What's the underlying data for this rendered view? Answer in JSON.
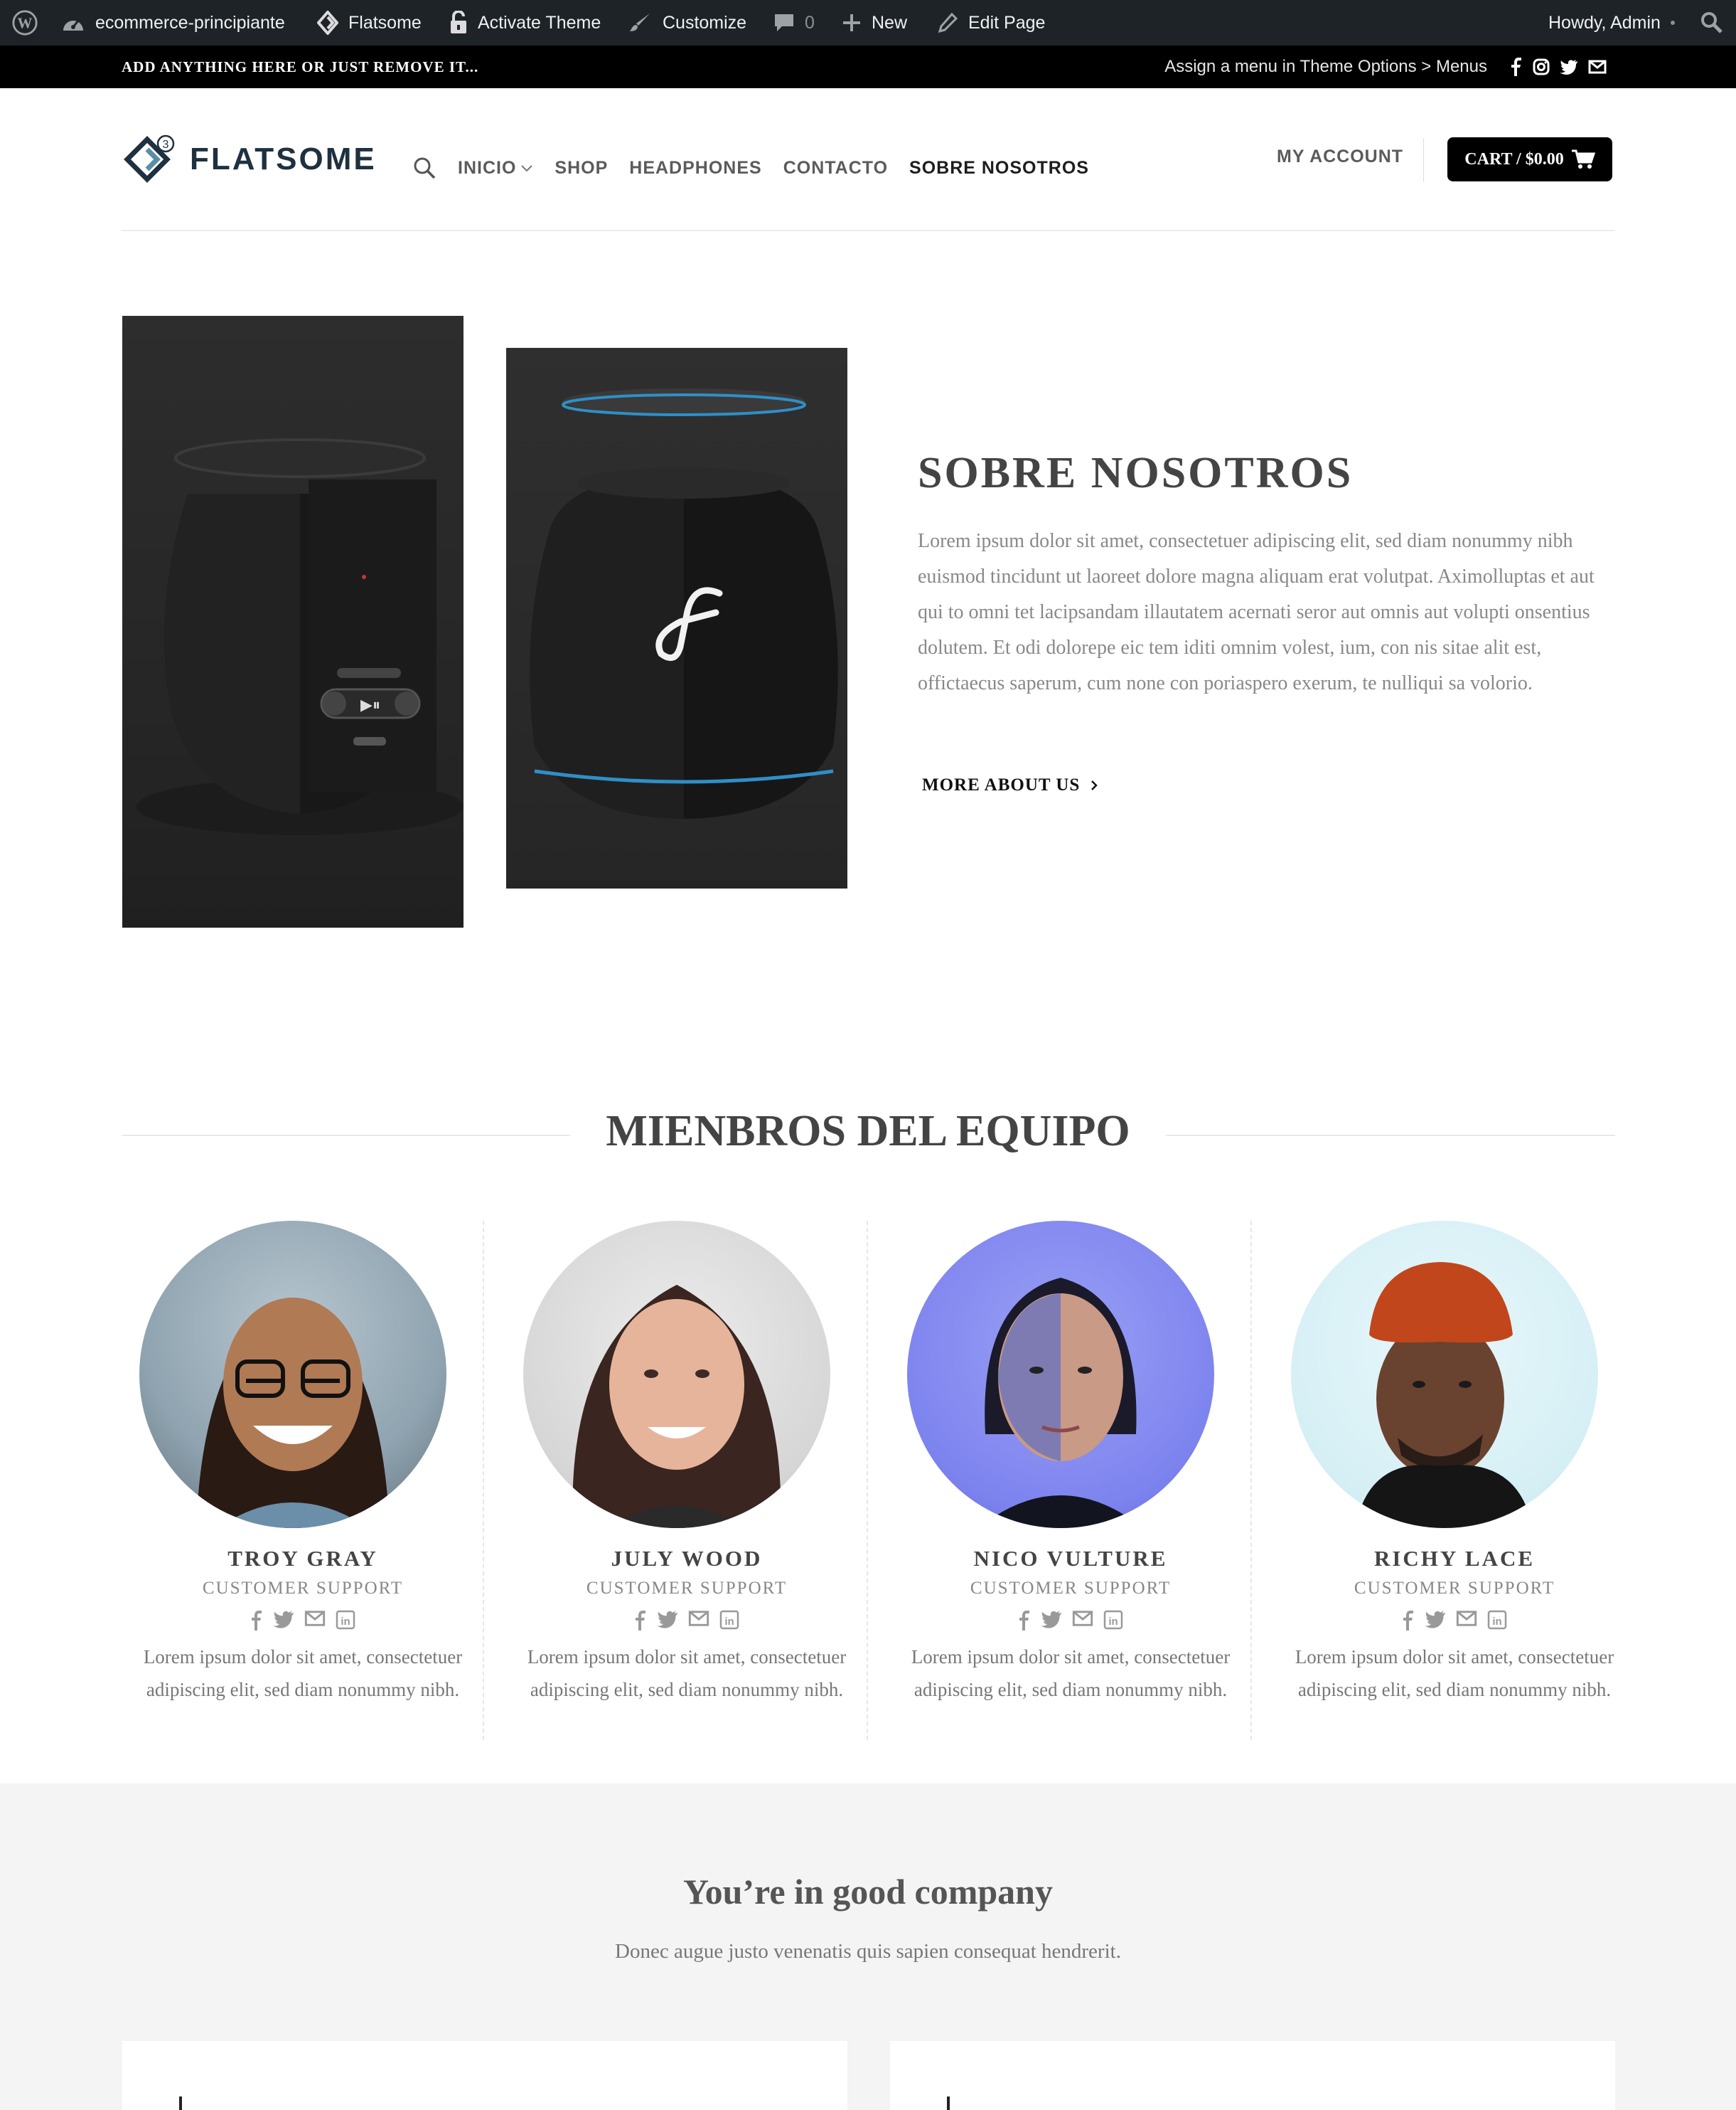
{
  "admin_bar": {
    "site_name": "ecommerce-principiante",
    "theme_name": "Flatsome",
    "activate_theme": "Activate Theme",
    "customize": "Customize",
    "comments_count": "0",
    "new": "New",
    "edit_page": "Edit Page",
    "howdy": "Howdy, Admin"
  },
  "top_bar": {
    "left_text": "ADD ANYTHING HERE OR JUST REMOVE IT...",
    "right_text": "Assign a menu in Theme Options > Menus",
    "social_icons": [
      "facebook-icon",
      "instagram-icon",
      "twitter-icon",
      "email-icon"
    ]
  },
  "header": {
    "logo_text": "FLATSOME",
    "logo_badge": "3",
    "nav": [
      "INICIO",
      "SHOP",
      "HEADPHONES",
      "CONTACTO",
      "SOBRE NOSOTROS"
    ],
    "nav_active": "SOBRE NOSOTROS",
    "my_account": "MY ACCOUNT",
    "cart": "CART / $0.00"
  },
  "about": {
    "title": "SOBRE NOSOTROS",
    "text": "Lorem ipsum dolor sit amet, consectetuer adipiscing elit, sed diam nonummy nibh euismod tincidunt ut laoreet dolore magna aliquam erat volutpat. Aximolluptas et aut qui to omni tet lacipsandam illautatem acernati seror aut omnis aut volupti onsentius dolutem. Et odi dolorepe eic tem iditi omnim volest, ium, con nis sitae alit est, offictaecus saperum, cum none con poriaspero exerum, te nulliqui sa volorio.",
    "more_link": "MORE ABOUT US"
  },
  "team": {
    "title": "MIENBROS DEL EQUIPO",
    "members": [
      {
        "name": "TROY GRAY",
        "role": "CUSTOMER SUPPORT",
        "bio": "Lorem ipsum dolor sit amet, consectetuer adipiscing elit, sed diam nonummy nibh."
      },
      {
        "name": "JULY WOOD",
        "role": "CUSTOMER SUPPORT",
        "bio": "Lorem ipsum dolor sit amet, consectetuer adipiscing elit, sed diam nonummy nibh."
      },
      {
        "name": "NICO VULTURE",
        "role": "CUSTOMER SUPPORT",
        "bio": "Lorem ipsum dolor sit amet, consectetuer adipiscing elit, sed diam nonummy nibh."
      },
      {
        "name": "RICHY LACE",
        "role": "CUSTOMER SUPPORT",
        "bio": "Lorem ipsum dolor sit amet, consectetuer adipiscing elit, sed diam nonummy nibh."
      }
    ]
  },
  "company": {
    "title": "You’re in good company",
    "subtitle": "Donec augue justo venenatis quis sapien consequat hendrerit."
  },
  "colors": {
    "admin_bar_bg": "#1d2327",
    "top_bar_bg": "#000000",
    "heading": "#444444",
    "logo": "#1f3140",
    "section_bg": "#f4f4f4"
  }
}
